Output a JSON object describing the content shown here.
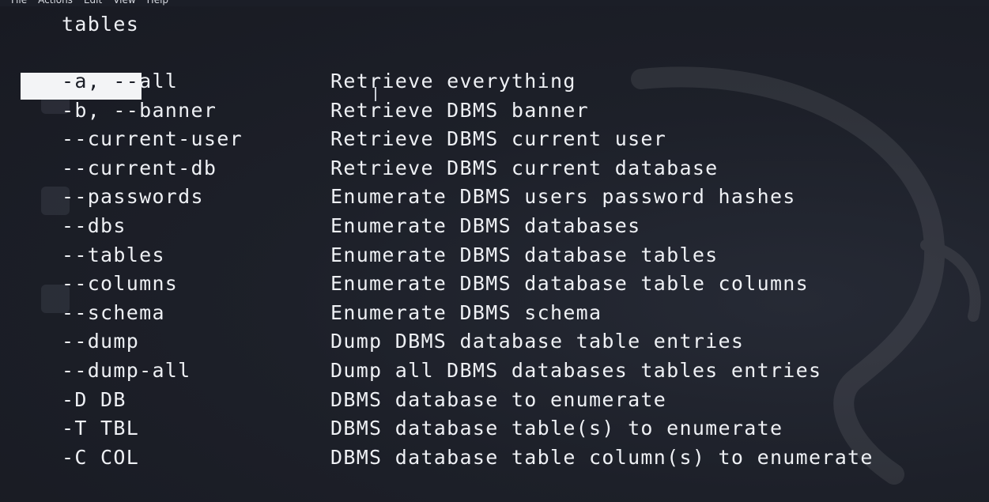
{
  "menubar": {
    "items": [
      "File",
      "Actions",
      "Edit",
      "View",
      "Help"
    ]
  },
  "terminal": {
    "heading": "tables",
    "rows": [
      {
        "option": "-a, --all",
        "description": "Retrieve everything"
      },
      {
        "option": "-b, --banner",
        "description": "Retrieve DBMS banner"
      },
      {
        "option": "--current-user",
        "description": "Retrieve DBMS current user"
      },
      {
        "option": "--current-db",
        "description": "Retrieve DBMS current database"
      },
      {
        "option": "--passwords",
        "description": "Enumerate DBMS users password hashes"
      },
      {
        "option": "--dbs",
        "description": "Enumerate DBMS databases"
      },
      {
        "option": "--tables",
        "description": "Enumerate DBMS database tables"
      },
      {
        "option": "--columns",
        "description": "Enumerate DBMS database table columns"
      },
      {
        "option": "--schema",
        "description": "Enumerate DBMS schema"
      },
      {
        "option": "--dump",
        "description": "Dump DBMS database table entries"
      },
      {
        "option": "--dump-all",
        "description": "Dump all DBMS databases tables entries"
      },
      {
        "option": "-D DB",
        "description": "DBMS database to enumerate"
      },
      {
        "option": "-T TBL",
        "description": "DBMS database table(s) to enumerate"
      },
      {
        "option": "-C COL",
        "description": "DBMS database table column(s) to enumerate"
      }
    ],
    "selected_text": "-a, --"
  },
  "colors": {
    "background": "#1b1e27",
    "text": "#eef0f4",
    "selection": "#f3f4f6"
  }
}
